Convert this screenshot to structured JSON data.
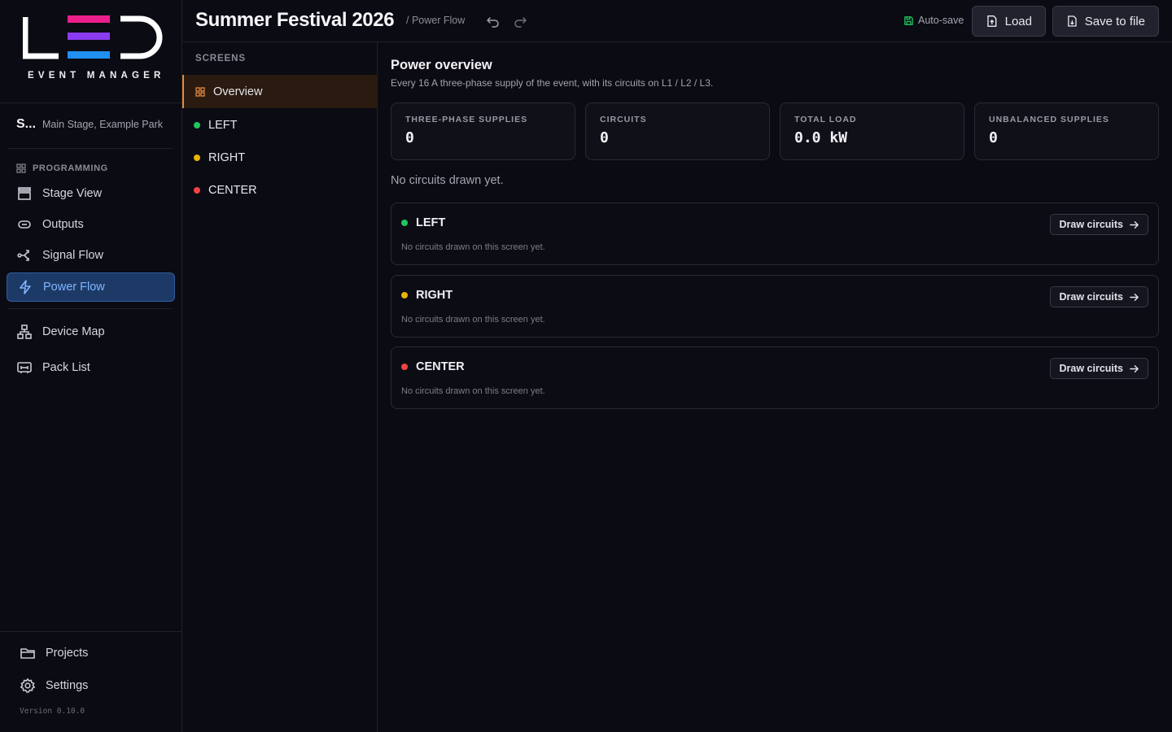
{
  "app": {
    "logo_text": "LED",
    "logo_subtitle": "EVENT MANAGER",
    "version": "Version 0.10.0"
  },
  "project": {
    "name": "S...",
    "location": "Main Stage, Example Park"
  },
  "sidebar": {
    "section_label": "PROGRAMMING",
    "items": [
      {
        "label": "Stage View",
        "icon": "stage-icon"
      },
      {
        "label": "Outputs",
        "icon": "outputs-icon"
      },
      {
        "label": "Signal Flow",
        "icon": "signal-flow-icon"
      },
      {
        "label": "Power Flow",
        "icon": "lightning-icon",
        "active": true
      },
      {
        "label": "Device Map",
        "icon": "device-map-icon"
      },
      {
        "label": "Pack List",
        "icon": "pack-list-icon"
      }
    ],
    "footer_items": [
      {
        "label": "Projects",
        "icon": "folder-icon"
      },
      {
        "label": "Settings",
        "icon": "gear-icon"
      }
    ]
  },
  "header": {
    "title": "Summer Festival 2026",
    "breadcrumb": "/ Power Flow",
    "autosave_label": "Auto-save",
    "load_label": "Load",
    "save_label": "Save to file"
  },
  "screens": {
    "heading": "SCREENS",
    "items": [
      {
        "label": "Overview",
        "active": true
      },
      {
        "label": "LEFT",
        "color": "#22c55e"
      },
      {
        "label": "RIGHT",
        "color": "#eab308"
      },
      {
        "label": "CENTER",
        "color": "#ef4444"
      }
    ]
  },
  "overview": {
    "title": "Power overview",
    "description": "Every 16 A three-phase supply of the event, with its circuits on L1 / L2 / L3.",
    "stats": [
      {
        "label": "THREE-PHASE SUPPLIES",
        "value": "0"
      },
      {
        "label": "CIRCUITS",
        "value": "0"
      },
      {
        "label": "TOTAL LOAD",
        "value": "0.0 kW"
      },
      {
        "label": "UNBALANCED SUPPLIES",
        "value": "0"
      }
    ],
    "empty_message": "No circuits drawn yet.",
    "cards": [
      {
        "name": "LEFT",
        "color": "#22c55e",
        "note": "No circuits drawn on this screen yet.",
        "action": "Draw circuits"
      },
      {
        "name": "RIGHT",
        "color": "#eab308",
        "note": "No circuits drawn on this screen yet.",
        "action": "Draw circuits"
      },
      {
        "name": "CENTER",
        "color": "#ef4444",
        "note": "No circuits drawn on this screen yet.",
        "action": "Draw circuits"
      }
    ]
  },
  "colors": {
    "accent_active_nav": "#1d3a66",
    "accent_active_screen": "#e58a3c",
    "autosave_green": "#22c55e"
  }
}
